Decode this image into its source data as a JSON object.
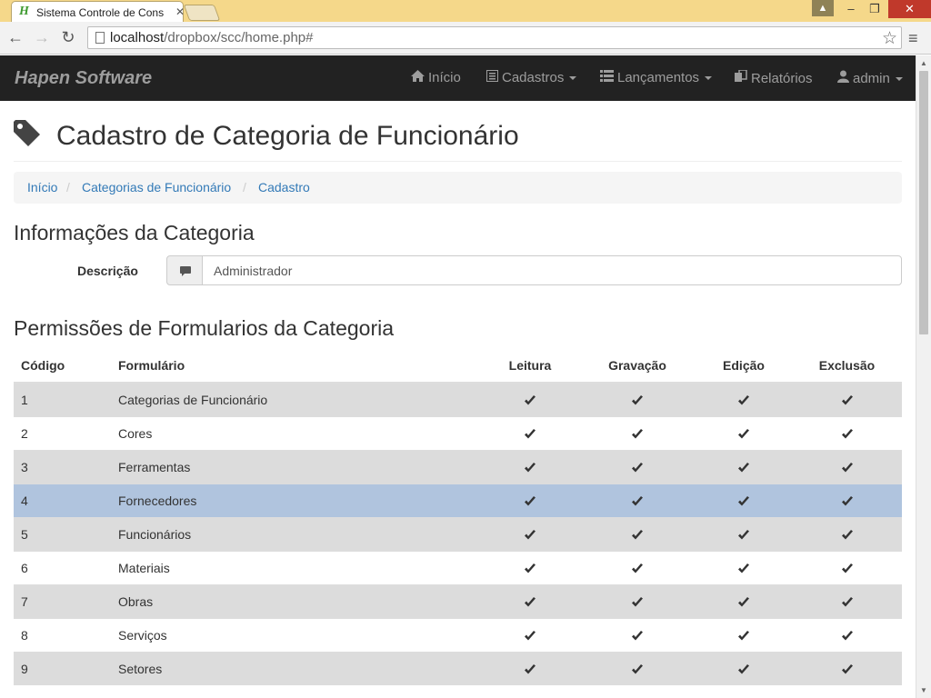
{
  "browser": {
    "tab_title": "Sistema Controle de Cons",
    "url_host": "localhost",
    "url_path": "/dropbox/scc/home.php#"
  },
  "navbar": {
    "brand": "Hapen Software",
    "items": [
      {
        "label": "Início",
        "icon": "home-icon"
      },
      {
        "label": "Cadastros",
        "icon": "list-alt-icon"
      },
      {
        "label": "Lançamentos",
        "icon": "th-list-icon"
      },
      {
        "label": "Relatórios",
        "icon": "duplicate-icon"
      },
      {
        "label": "admin",
        "icon": "user-icon"
      }
    ]
  },
  "page": {
    "title": "Cadastro de Categoria de Funcionário",
    "breadcrumb": [
      "Início",
      "Categorias de Funcionário",
      "Cadastro"
    ],
    "section_info": "Informações da Categoria",
    "description_label": "Descrição",
    "description_value": "Administrador",
    "section_permissions": "Permissões de Formularios da Categoria"
  },
  "table": {
    "headers": [
      "Código",
      "Formulário",
      "Leitura",
      "Gravação",
      "Edição",
      "Exclusão"
    ],
    "rows": [
      {
        "codigo": "1",
        "formulario": "Categorias de Funcionário",
        "leitura": true,
        "gravacao": true,
        "edicao": true,
        "exclusao": true
      },
      {
        "codigo": "2",
        "formulario": "Cores",
        "leitura": true,
        "gravacao": true,
        "edicao": true,
        "exclusao": true
      },
      {
        "codigo": "3",
        "formulario": "Ferramentas",
        "leitura": true,
        "gravacao": true,
        "edicao": true,
        "exclusao": true
      },
      {
        "codigo": "4",
        "formulario": "Fornecedores",
        "leitura": true,
        "gravacao": true,
        "edicao": true,
        "exclusao": true
      },
      {
        "codigo": "5",
        "formulario": "Funcionários",
        "leitura": true,
        "gravacao": true,
        "edicao": true,
        "exclusao": true
      },
      {
        "codigo": "6",
        "formulario": "Materiais",
        "leitura": true,
        "gravacao": true,
        "edicao": true,
        "exclusao": true
      },
      {
        "codigo": "7",
        "formulario": "Obras",
        "leitura": true,
        "gravacao": true,
        "edicao": true,
        "exclusao": true
      },
      {
        "codigo": "8",
        "formulario": "Serviços",
        "leitura": true,
        "gravacao": true,
        "edicao": true,
        "exclusao": true
      },
      {
        "codigo": "9",
        "formulario": "Setores",
        "leitura": true,
        "gravacao": true,
        "edicao": true,
        "exclusao": true
      }
    ],
    "selected_row": "4"
  },
  "colors": {
    "navbar_bg": "#222222",
    "link": "#337ab7",
    "row_stripe": "#dcdcdc",
    "row_selected": "#b0c4de"
  }
}
